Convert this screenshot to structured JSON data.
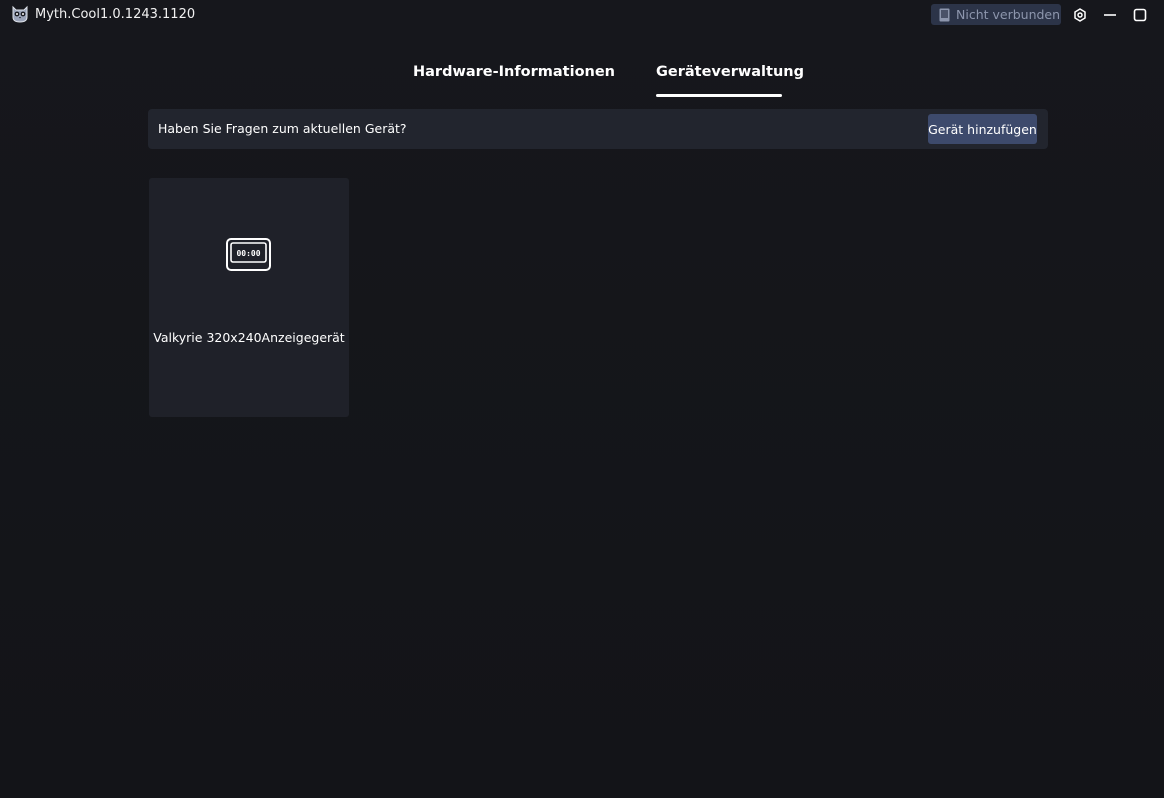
{
  "titlebar": {
    "app_name": "Myth.Cool",
    "version": "1.0.1243.1120",
    "logo_icon": "owl-logo-icon",
    "connection_status": "Nicht verbunden",
    "connection_icon": "device-disconnected-icon",
    "settings_icon": "gear-icon",
    "minimize_icon": "minimize-icon",
    "maximize_icon": "maximize-icon"
  },
  "tabs": [
    {
      "label": "Hardware-Informationen",
      "active": false
    },
    {
      "label": "Geräteverwaltung",
      "active": true
    }
  ],
  "infobar": {
    "question": "Haben Sie Fragen zum aktuellen Gerät?",
    "add_device_label": "Gerät hinzufügen"
  },
  "devices": [
    {
      "name": "Valkyrie 320x240Anzeigegerät",
      "icon": "display-device-icon",
      "icon_text": "00:00"
    }
  ],
  "colors": {
    "background": "#131418",
    "panel": "#22252e",
    "card": "#1f2129",
    "accent_button": "#3d4a6c",
    "status_chip": "#2c3448",
    "status_text": "#8d96ad"
  }
}
